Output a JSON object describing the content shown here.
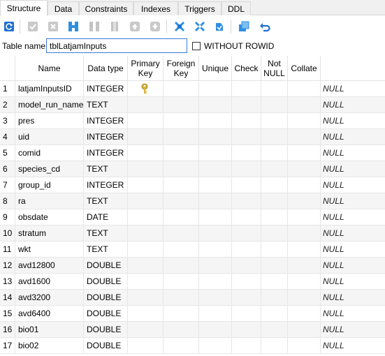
{
  "tabs": [
    "Structure",
    "Data",
    "Constraints",
    "Indexes",
    "Triggers",
    "DDL"
  ],
  "toolbar": {
    "buttons": [
      "refresh-icon",
      "commit-icon",
      "rollback-icon",
      "add-column-icon",
      "delete-column-icon",
      "edit-column-icon",
      "move-up-icon",
      "move-down-icon",
      "add-pk-icon",
      "add-fk-icon",
      "add-unique-icon",
      "copy-icon",
      "undo-icon"
    ]
  },
  "table_name": {
    "label": "Table name:",
    "value": "tblLatjamInputs"
  },
  "without_rowid": {
    "label": "WITHOUT ROWID",
    "checked": false
  },
  "columns_header": [
    "Name",
    "Data type",
    "Primary\nKey",
    "Foreign\nKey",
    "Unique",
    "Check",
    "Not\nNULL",
    "Collate"
  ],
  "default_label": "NULL",
  "rows": [
    {
      "num": "1",
      "name": "latjamInputsID",
      "type": "INTEGER",
      "pk": true
    },
    {
      "num": "2",
      "name": "model_run_name",
      "type": "TEXT",
      "pk": false
    },
    {
      "num": "3",
      "name": "pres",
      "type": "INTEGER",
      "pk": false
    },
    {
      "num": "4",
      "name": "uid",
      "type": "INTEGER",
      "pk": false
    },
    {
      "num": "5",
      "name": "comid",
      "type": "INTEGER",
      "pk": false
    },
    {
      "num": "6",
      "name": "species_cd",
      "type": "TEXT",
      "pk": false
    },
    {
      "num": "7",
      "name": "group_id",
      "type": "INTEGER",
      "pk": false
    },
    {
      "num": "8",
      "name": "ra",
      "type": "TEXT",
      "pk": false
    },
    {
      "num": "9",
      "name": "obsdate",
      "type": "DATE",
      "pk": false
    },
    {
      "num": "10",
      "name": "stratum",
      "type": "TEXT",
      "pk": false
    },
    {
      "num": "11",
      "name": "wkt",
      "type": "TEXT",
      "pk": false
    },
    {
      "num": "12",
      "name": "avd12800",
      "type": "DOUBLE",
      "pk": false
    },
    {
      "num": "13",
      "name": "avd1600",
      "type": "DOUBLE",
      "pk": false
    },
    {
      "num": "14",
      "name": "avd3200",
      "type": "DOUBLE",
      "pk": false
    },
    {
      "num": "15",
      "name": "avd6400",
      "type": "DOUBLE",
      "pk": false
    },
    {
      "num": "16",
      "name": "bio01",
      "type": "DOUBLE",
      "pk": false
    },
    {
      "num": "17",
      "name": "bio02",
      "type": "DOUBLE",
      "pk": false
    }
  ],
  "colors": {
    "accent": "#3b7bd5",
    "key_icon": "#d9b23a",
    "refresh": "#1f6fd1",
    "add": "#2e8fe0"
  }
}
